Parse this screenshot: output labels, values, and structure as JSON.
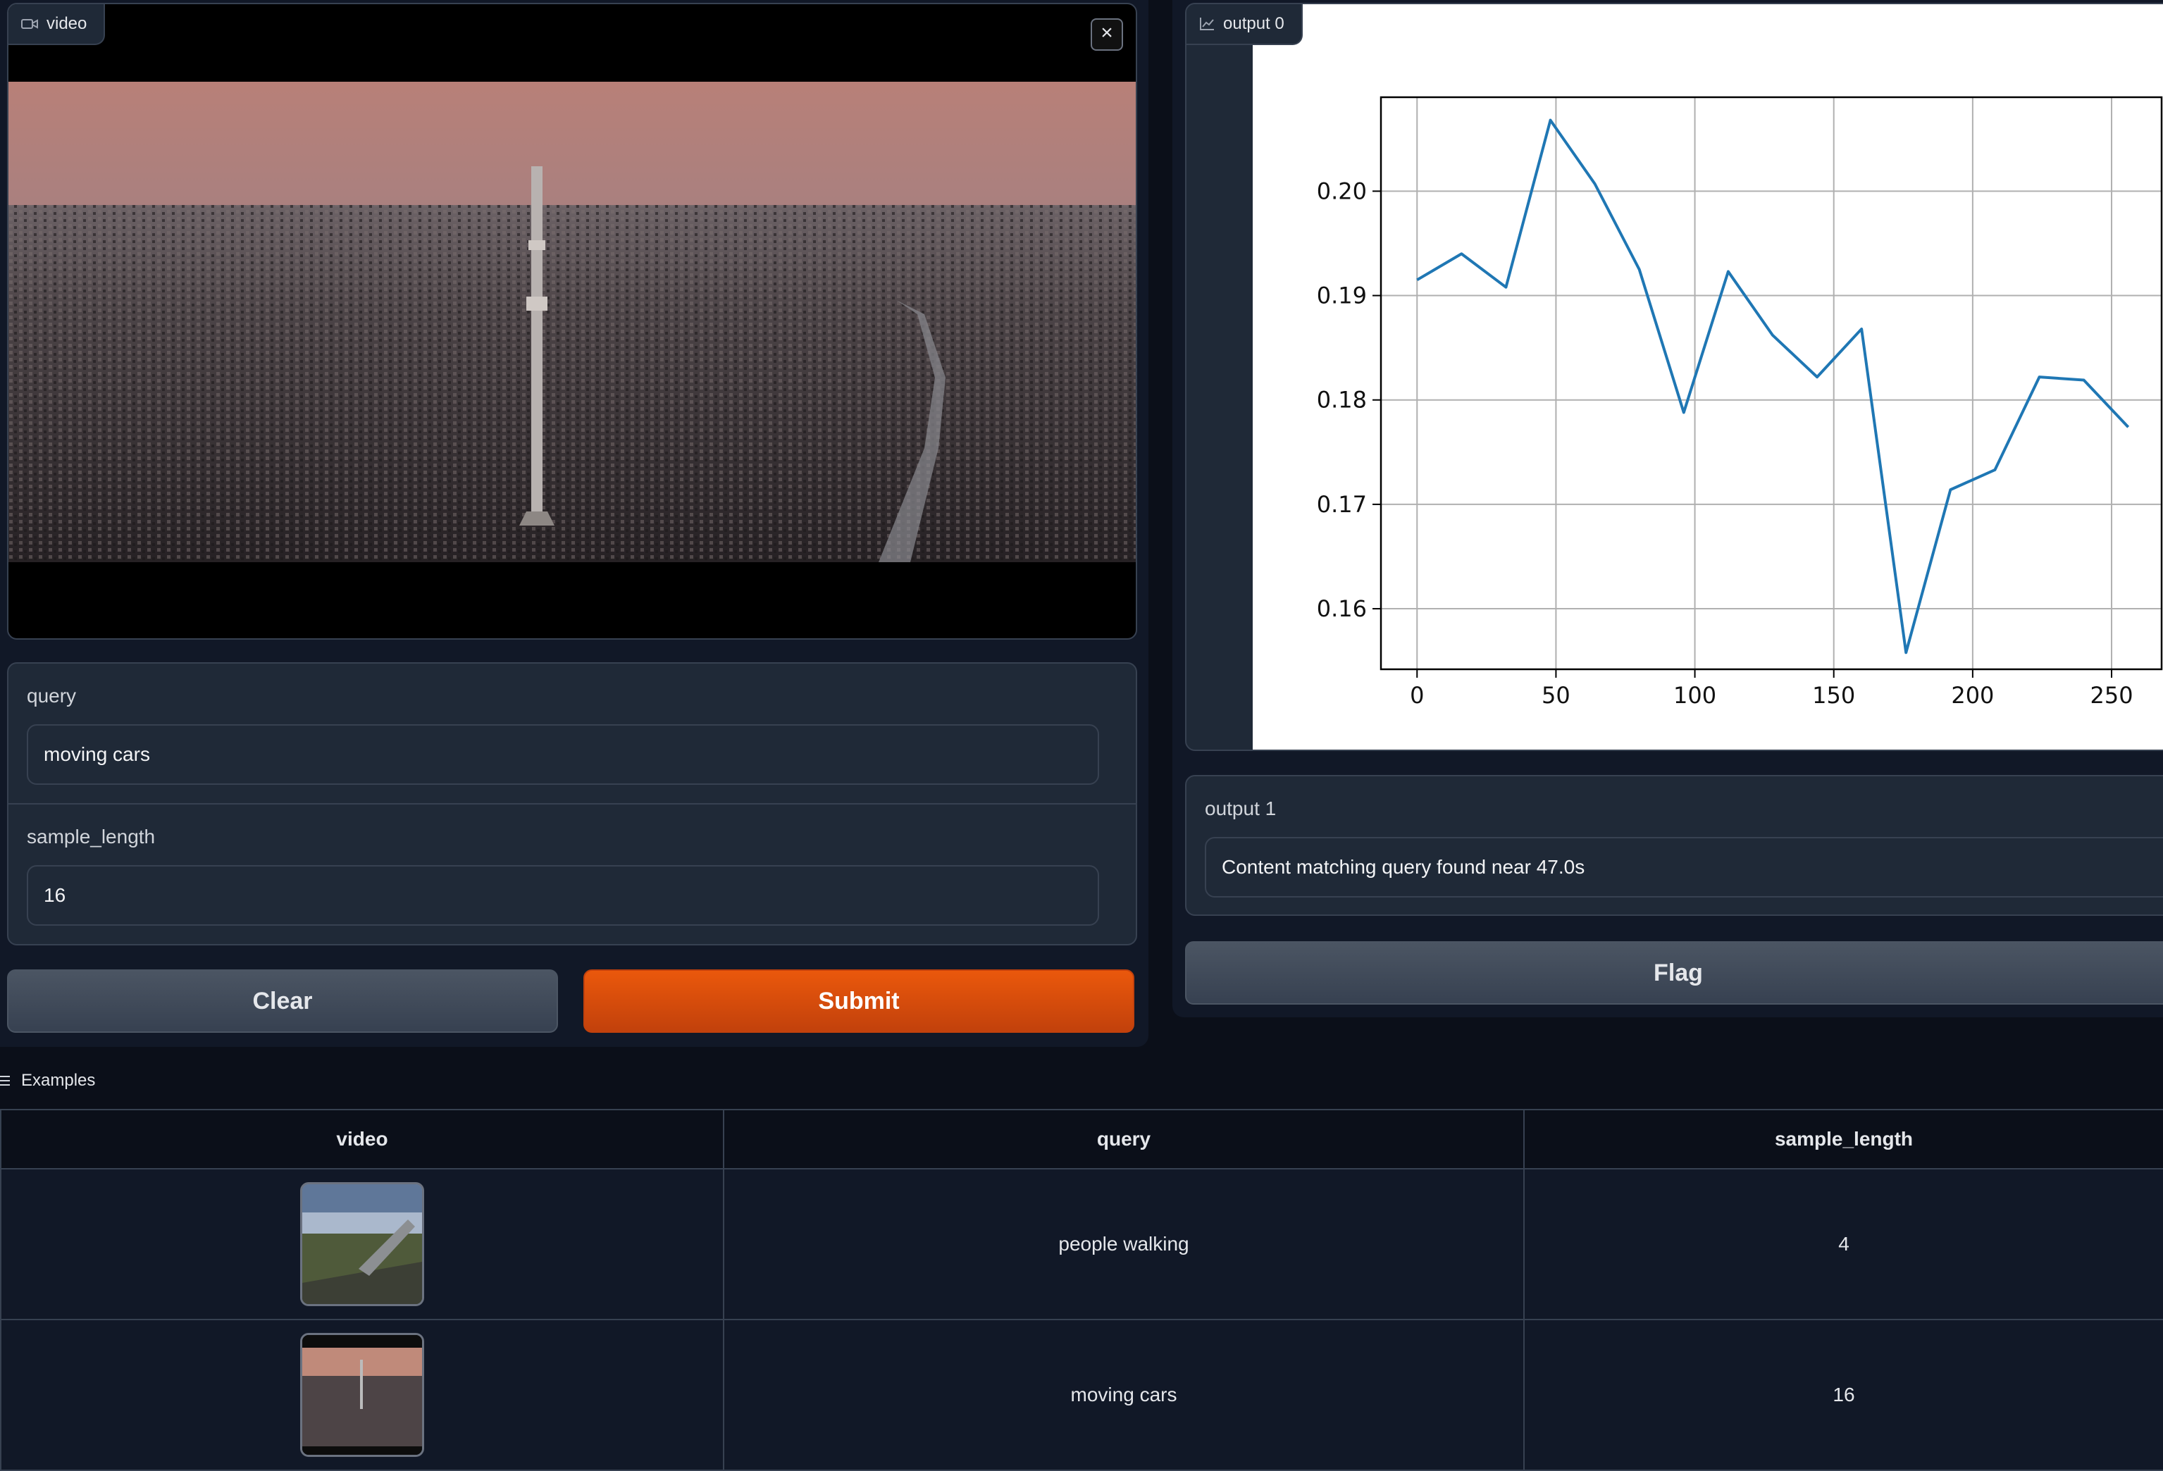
{
  "video_block": {
    "label": "video",
    "icon": "video-camera-icon",
    "close": "×"
  },
  "inputs": {
    "query": {
      "label": "query",
      "value": "moving cars"
    },
    "sample_length": {
      "label": "sample_length",
      "value": "16"
    }
  },
  "buttons": {
    "clear": "Clear",
    "submit": "Submit",
    "flag": "Flag"
  },
  "plot_block": {
    "label": "output 0",
    "icon": "chart-icon"
  },
  "chart_data": {
    "type": "line",
    "title": "",
    "xlabel": "",
    "ylabel": "",
    "x": [
      0,
      16,
      32,
      48,
      64,
      80,
      96,
      112,
      128,
      144,
      160,
      176,
      192,
      208,
      224,
      240,
      256
    ],
    "series": [
      {
        "values": [
          0.1915,
          0.194,
          0.1908,
          0.2068,
          0.2007,
          0.1925,
          0.1788,
          0.1923,
          0.1862,
          0.1822,
          0.1868,
          0.1558,
          0.1714,
          0.1733,
          0.1822,
          0.1819,
          0.1774
        ]
      }
    ],
    "xlim": [
      -13,
      268
    ],
    "ylim": [
      0.1542,
      0.209
    ],
    "xticks": [
      0,
      50,
      100,
      150,
      200,
      250
    ],
    "yticks": [
      0.16,
      0.17,
      0.18,
      0.19,
      0.2
    ],
    "ytick_labels": [
      "0.16",
      "0.17",
      "0.18",
      "0.19",
      "0.20"
    ],
    "grid": true,
    "line_color": "#1f77b4"
  },
  "output1": {
    "label": "output 1",
    "value": "Content matching query found near 47.0s"
  },
  "examples": {
    "label": "Examples",
    "headers": [
      "video",
      "query",
      "sample_length"
    ],
    "rows": [
      {
        "query": "people walking",
        "sample_length": "4"
      },
      {
        "query": "moving cars",
        "sample_length": "16"
      }
    ]
  }
}
